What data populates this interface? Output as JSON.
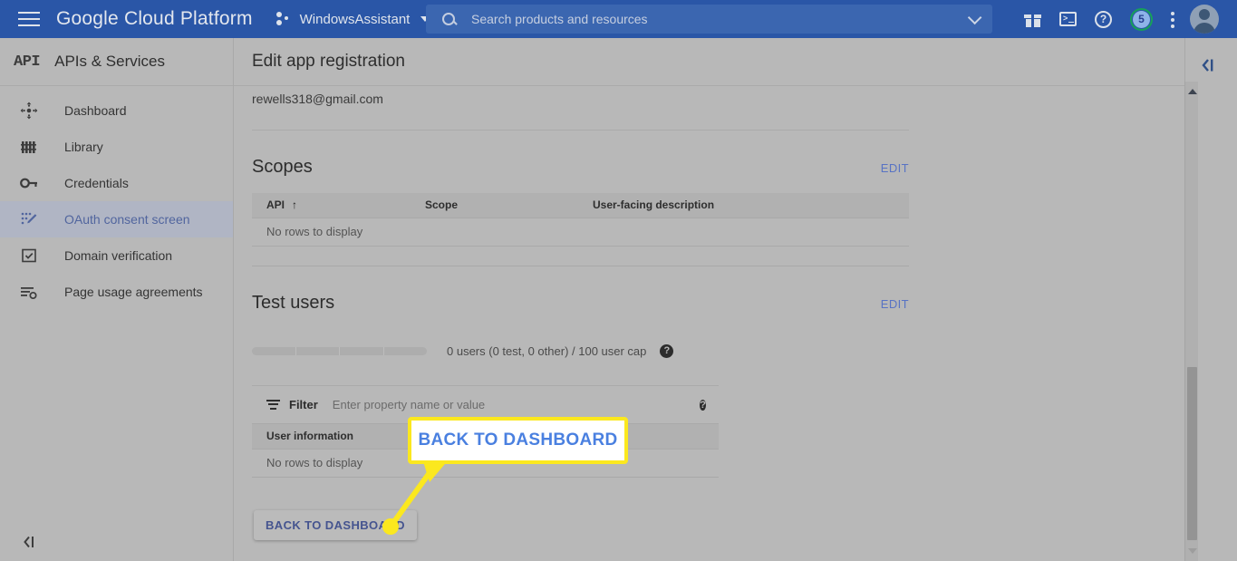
{
  "topbar": {
    "menu_icon": "hamburger-icon",
    "brand": "Google Cloud Platform",
    "project_name": "WindowsAssistant",
    "project_caret": "chevron-down-icon",
    "search": {
      "icon": "search-icon",
      "placeholder": "Search products and resources",
      "value": "",
      "chevron": "chevron-down-icon"
    },
    "icons": [
      {
        "name": "gift-icon",
        "label": "Release notes"
      },
      {
        "name": "cloud-shell-icon",
        "label": "Activate Cloud Shell"
      },
      {
        "name": "help-icon",
        "label": "Help"
      },
      {
        "name": "notifications-icon",
        "label": "Notifications",
        "badge": "5"
      },
      {
        "name": "more-vert-icon",
        "label": "More options"
      },
      {
        "name": "account-avatar",
        "label": "Account"
      }
    ],
    "notification_count": "5",
    "accent_color": "#2a56a7",
    "badge_ring_color": "#17a05a"
  },
  "sidebar": {
    "logo_text": "API",
    "title": "APIs & Services",
    "items": [
      {
        "label": "Dashboard",
        "icon": "dashboard-icon",
        "active": false
      },
      {
        "label": "Library",
        "icon": "library-icon",
        "active": false
      },
      {
        "label": "Credentials",
        "icon": "key-icon",
        "active": false
      },
      {
        "label": "OAuth consent screen",
        "icon": "oauth-consent-icon",
        "active": true
      },
      {
        "label": "Domain verification",
        "icon": "domain-verification-icon",
        "active": false
      },
      {
        "label": "Page usage agreements",
        "icon": "page-usage-agreements-icon",
        "active": false
      }
    ],
    "collapse_icon": "collapse-panel-icon",
    "active_text_color": "#51659e"
  },
  "main": {
    "page_title": "Edit app registration",
    "partial_email": "rewells318@gmail.com",
    "scopes": {
      "title": "Scopes",
      "edit_label": "EDIT",
      "columns": [
        "API",
        "Scope",
        "User-facing description"
      ],
      "sort_column": "API",
      "sort_arrow": "↑",
      "empty_text": "No rows to display",
      "rows": []
    },
    "test_users": {
      "title": "Test users",
      "edit_label": "EDIT",
      "usage_text": "0 users (0 test, 0 other) / 100 user cap",
      "usage_help_icon": "help-icon",
      "progress_segments": 4,
      "progress_percent": 0,
      "filter": {
        "icon": "filter-icon",
        "label": "Filter",
        "placeholder": "Enter property name or value",
        "value": "",
        "help_icon": "help-icon"
      },
      "columns": [
        "User information"
      ],
      "empty_text": "No rows to display",
      "rows": []
    },
    "back_button_label": "BACK TO DASHBOARD"
  },
  "annotation": {
    "callout_text": "BACK TO DASHBOARD",
    "highlight_color": "#fbe81e",
    "callout_text_color": "#4a80e0"
  },
  "right_rail": {
    "collapse_icon": "collapse-panel-icon"
  },
  "scrollbar": {
    "up_icon": "scroll-up-arrow",
    "down_icon": "scroll-down-arrow"
  }
}
